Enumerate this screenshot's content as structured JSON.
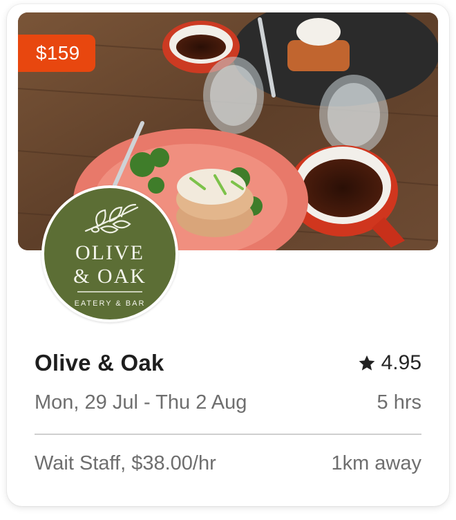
{
  "listing": {
    "price": "$159",
    "venue_name": "Olive & Oak",
    "rating": "4.95",
    "dates": "Mon, 29 Jul - Thu 2 Aug",
    "duration": "5 hrs",
    "role_rate": "Wait Staff, $38.00/hr",
    "distance": "1km away"
  },
  "logo": {
    "line1": "OLIVE",
    "line2": "& OAK",
    "tagline": "EATERY & BAR"
  },
  "icons": {
    "rating": "star-icon",
    "logo_mark": "olive-branch-icon"
  },
  "colors": {
    "price_badge": "#e8470f",
    "logo_bg": "#5c6e35"
  }
}
